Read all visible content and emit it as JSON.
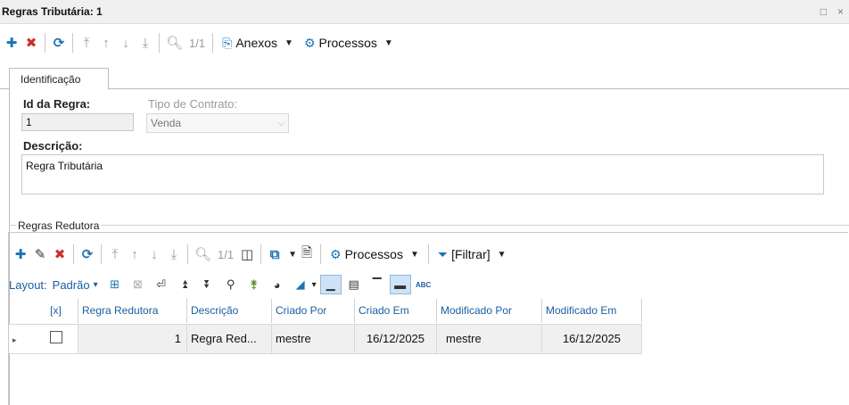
{
  "window": {
    "title": "Regras Tributária: 1",
    "restore_icon": "□",
    "close_icon": "×"
  },
  "main_toolbar": {
    "counter": "1/1",
    "anexos_label": "Anexos",
    "processos_label": "Processos"
  },
  "tabs": [
    {
      "label": "Identificação"
    }
  ],
  "form": {
    "id_label": "Id da Regra:",
    "id_value": "1",
    "tipo_label": "Tipo de Contrato:",
    "tipo_value": "Venda",
    "descricao_label": "Descrição:",
    "descricao_value": "Regra Tributária"
  },
  "sub_section": {
    "title": "Regras Redutora",
    "counter": "1/1",
    "processos_label": "Processos",
    "filtrar_label": "[Filtrar]",
    "layout_label": "Layout:",
    "layout_value": "Padrão",
    "abc_label": "ABC"
  },
  "table": {
    "columns": [
      "[x]",
      "Regra Redutora",
      "Descrição",
      "Criado Por",
      "Criado Em",
      "Modificado Por",
      "Modificado Em"
    ],
    "rows": [
      {
        "checked": false,
        "regra": "1",
        "descricao": "Regra Red...",
        "criado_por": "mestre",
        "criado_em": "16/12/2025",
        "modificado_por": "mestre",
        "modificado_em": "16/12/2025"
      }
    ]
  },
  "colors": {
    "accent": "#1a73b5",
    "delete": "#c9302c",
    "header_text": "#1a5fa3"
  }
}
